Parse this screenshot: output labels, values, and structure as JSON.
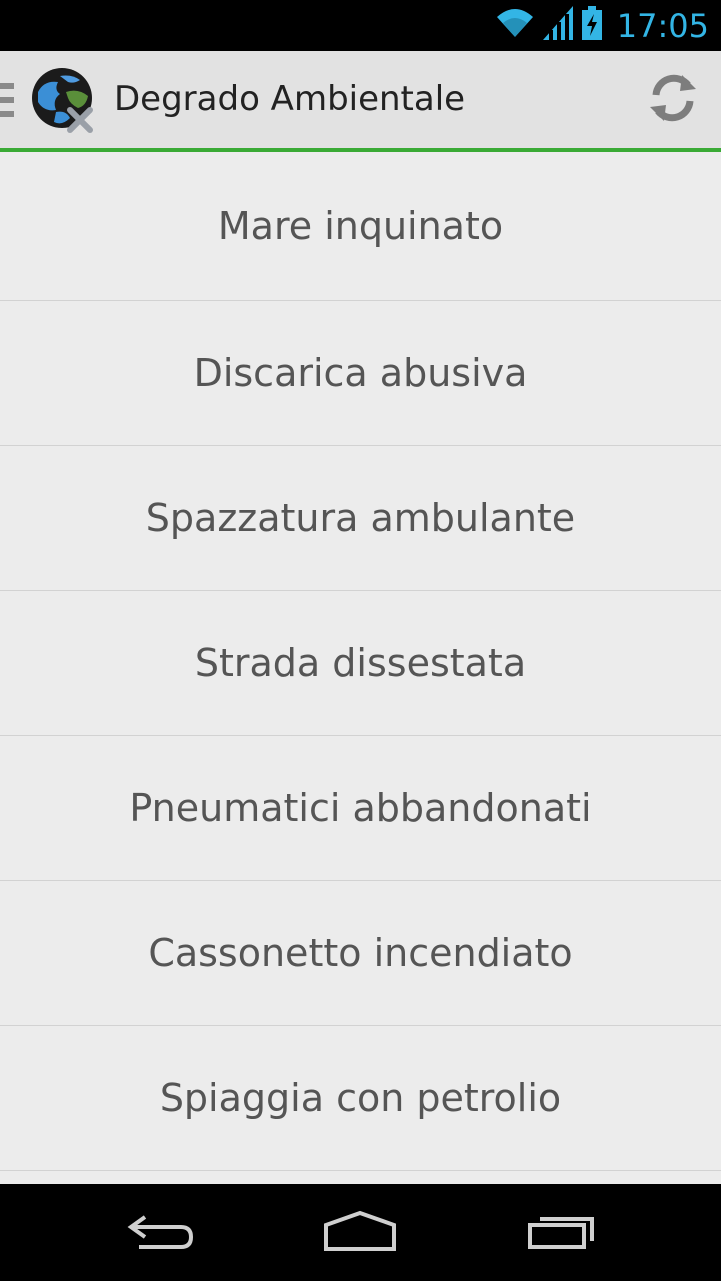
{
  "status_bar": {
    "time": "17:05",
    "icons": [
      "wifi-icon",
      "cell-signal-icon",
      "battery-charging-icon"
    ],
    "accent_color": "#33b5e5"
  },
  "action_bar": {
    "title": "Degrado Ambientale",
    "logo_icon": "earth-logo-icon",
    "refresh_icon": "refresh-icon",
    "accent_color": "#3aaa35"
  },
  "list": {
    "items": [
      {
        "label": "Mare inquinato"
      },
      {
        "label": "Discarica abusiva"
      },
      {
        "label": "Spazzatura ambulante"
      },
      {
        "label": "Strada dissestata"
      },
      {
        "label": "Pneumatici abbandonati"
      },
      {
        "label": "Cassonetto incendiato"
      },
      {
        "label": "Spiaggia con petrolio"
      }
    ]
  },
  "nav_bar": {
    "buttons": [
      "back-icon",
      "home-icon",
      "recent-apps-icon"
    ]
  }
}
